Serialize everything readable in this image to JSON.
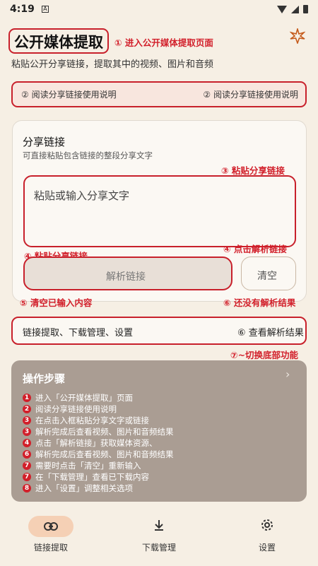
{
  "status": {
    "time": "4:19",
    "sim_icon": "A"
  },
  "header": {
    "title": "公开媒体提取",
    "subtitle": "粘贴公开分享链接，提取其中的视频、图片和音频",
    "settings_icon": "spark-icon"
  },
  "annotations": {
    "a1": "① 进入公开媒体提取页面",
    "a2_left": "② 阅读分享链接使用说明",
    "a2_right": "② 阅读分享链接使用说明",
    "a3": "③ 粘贴分享链接",
    "a4_left": "④ 粘贴分享链接",
    "a4_right": "④ 点击解析链接",
    "a5": "⑤ 清空已输入内容",
    "a6_right": "⑥ 还没有解析结果",
    "a6_row": "⑥ 查看解析结果",
    "a7": "⑦~切换底部功能"
  },
  "share_card": {
    "title": "分享链接",
    "subtitle": "可直接粘贴包含链接的整段分享文字",
    "placeholder": "粘贴或输入分享文字",
    "parse_button": "解析链接",
    "clear_button": "清空"
  },
  "links_row": {
    "left": "链接提取、下载管理、设置"
  },
  "steps": {
    "title": "操作步骤",
    "items": [
      {
        "num": "1",
        "text": "进入「公开媒体提取」页面"
      },
      {
        "num": "2",
        "text": "阅读分享链接使用说明"
      },
      {
        "num": "3",
        "text": "在点击入框粘贴分享文字或链接"
      },
      {
        "num": "3",
        "text": "解析完成后查看视频、图片和音频结果"
      },
      {
        "num": "4",
        "text": "点击「解析链接」获取媒体资源、"
      },
      {
        "num": "6",
        "text": "解析完成后查看视频、图片和音频结果"
      },
      {
        "num": "7",
        "text": "需要时点击「清空」重新输入"
      },
      {
        "num": "7",
        "text": "在「下载管理」查看已下载内容"
      },
      {
        "num": "8",
        "text": "进入「设置」调整相关选项"
      }
    ]
  },
  "bottom_nav": [
    {
      "label": "链接提取",
      "icon": "link-icon",
      "active": true
    },
    {
      "label": "下载管理",
      "icon": "download-icon",
      "active": false
    },
    {
      "label": "设置",
      "icon": "gear-icon",
      "active": false
    }
  ],
  "colors": {
    "accent": "#c8202b",
    "active_pill": "#f5d0b5",
    "steps_bg": "#aa9d93"
  }
}
